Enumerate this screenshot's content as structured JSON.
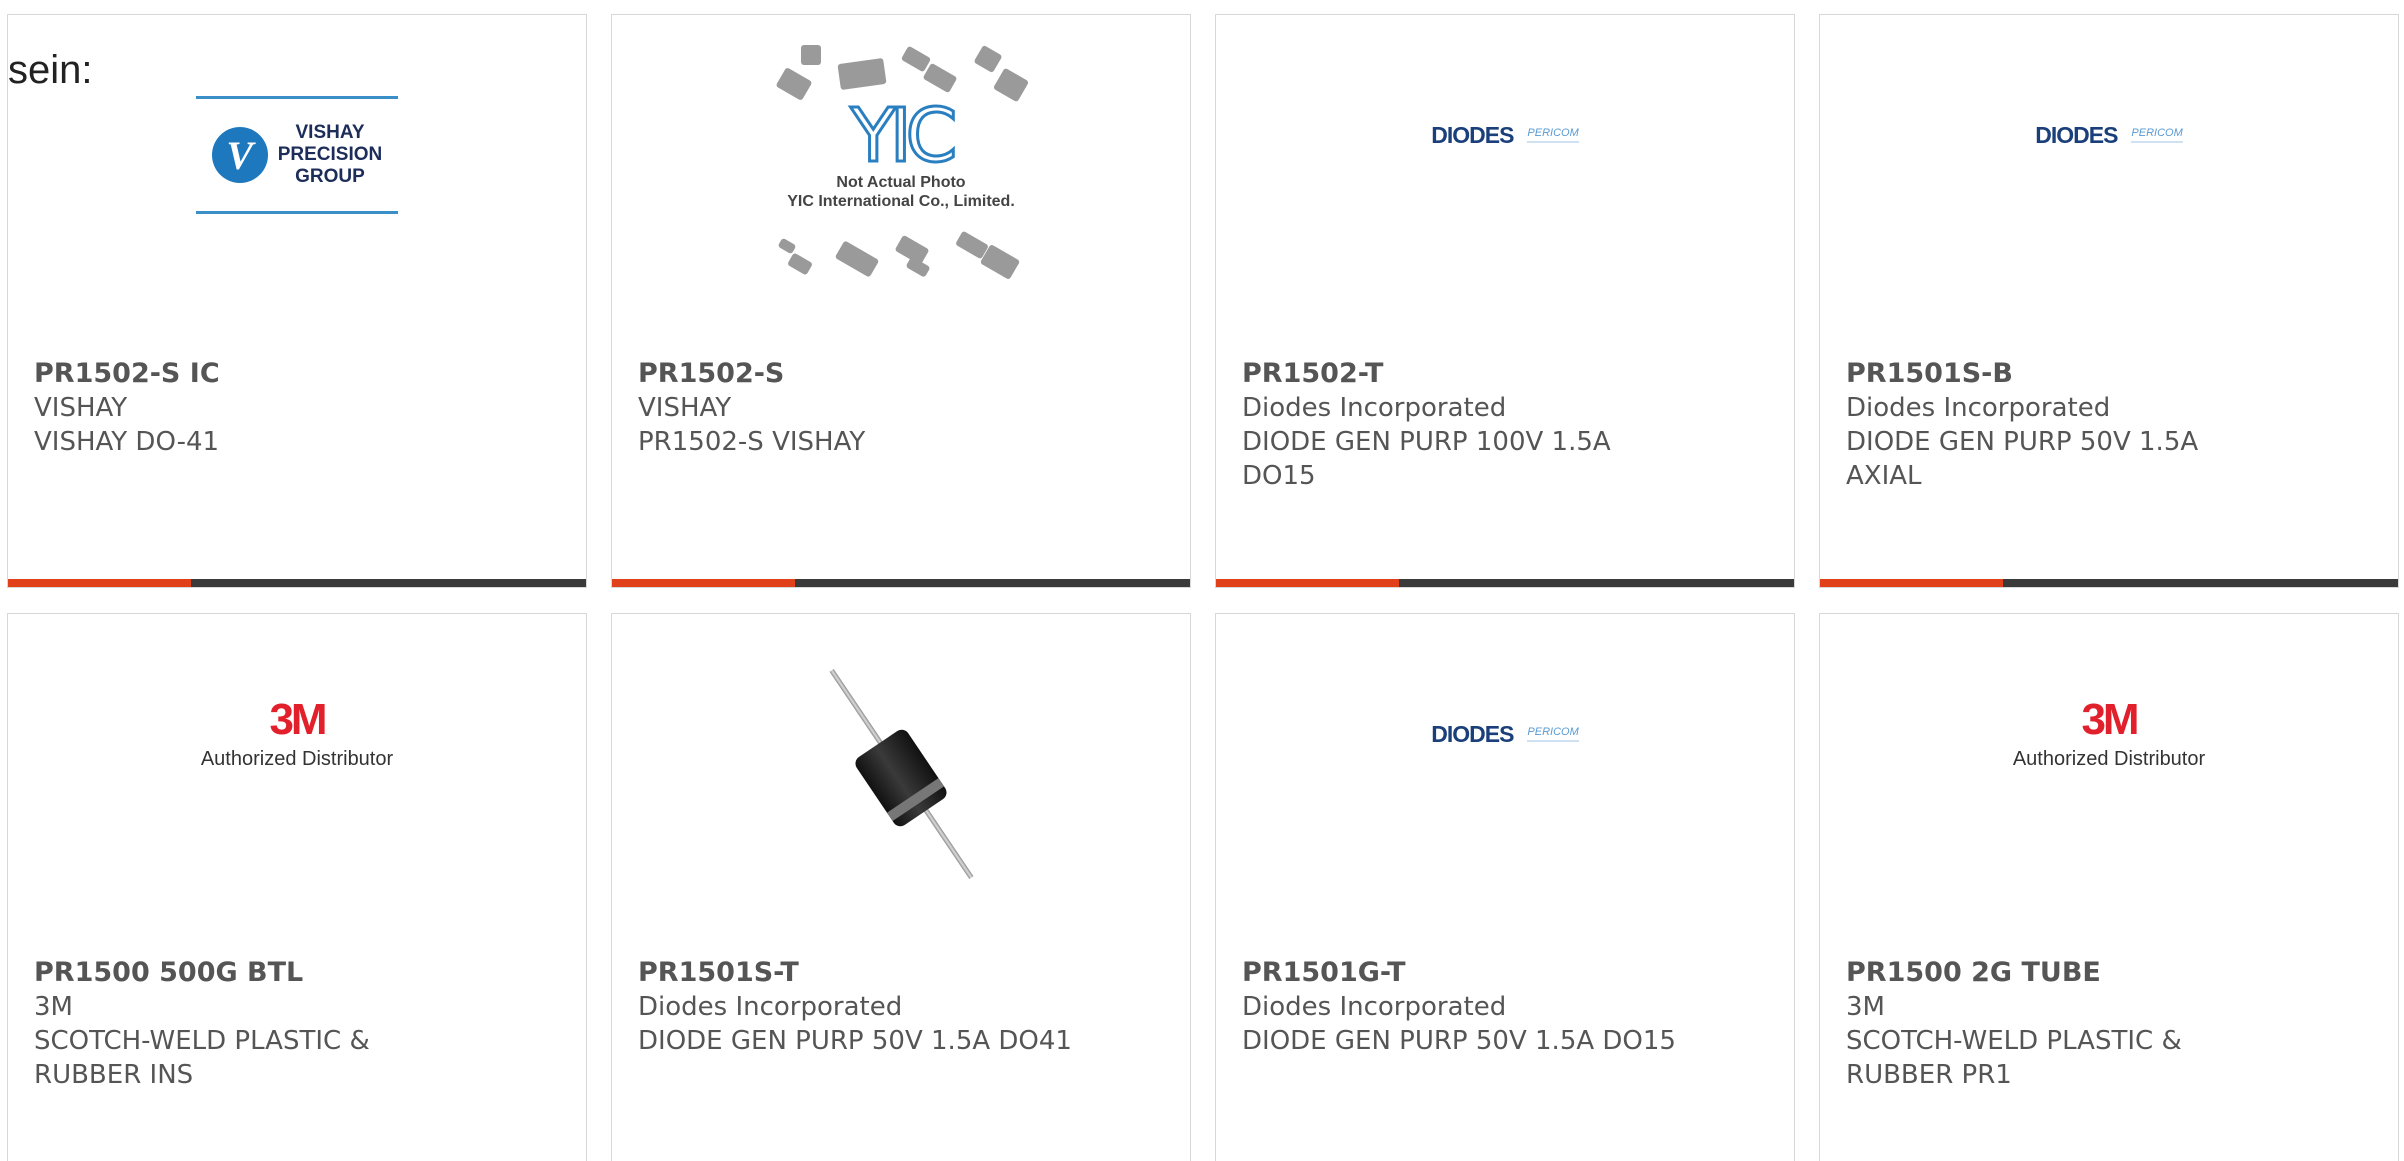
{
  "intro_text": "sein:",
  "colors": {
    "accent": "#e0401a",
    "bar": "#3a3a3a",
    "text": "#555555"
  },
  "products": [
    {
      "part_number": "PR1502-S IC",
      "manufacturer": "VISHAY",
      "description": "VISHAY DO-41",
      "image": "vishay-logo",
      "logo": {
        "lines": [
          "VISHAY",
          "PRECISION",
          "GROUP"
        ]
      }
    },
    {
      "part_number": "PR1502-S",
      "manufacturer": "VISHAY",
      "description": "PR1502-S VISHAY",
      "image": "yic-placeholder",
      "logo": {
        "letters": "YIC",
        "note_line1": "Not Actual Photo",
        "note_line2": "YIC International Co., Limited."
      }
    },
    {
      "part_number": "PR1502-T",
      "manufacturer": "Diodes Incorporated",
      "description": "DIODE GEN PURP 100V 1.5A DO15",
      "image": "diodes-logo",
      "logo": {
        "brand": "DIODES",
        "sub": "PERICOM"
      }
    },
    {
      "part_number": "PR1501S-B",
      "manufacturer": "Diodes Incorporated",
      "description": "DIODE GEN PURP 50V 1.5A AXIAL",
      "image": "diodes-logo",
      "logo": {
        "brand": "DIODES",
        "sub": "PERICOM"
      }
    },
    {
      "part_number": "PR1500 500G BTL",
      "manufacturer": "3M",
      "description": "SCOTCH-WELD PLASTIC & RUBBER INS",
      "image": "3m-logo",
      "logo": {
        "brand": "3M",
        "sub": "Authorized Distributor"
      }
    },
    {
      "part_number": "PR1501S-T",
      "manufacturer": "Diodes Incorporated",
      "description": "DIODE GEN PURP 50V 1.5A DO41",
      "image": "diode-photo"
    },
    {
      "part_number": "PR1501G-T",
      "manufacturer": "Diodes Incorporated",
      "description": "DIODE GEN PURP 50V 1.5A DO15",
      "image": "diodes-logo",
      "logo": {
        "brand": "DIODES",
        "sub": "PERICOM"
      }
    },
    {
      "part_number": "PR1500 2G TUBE",
      "manufacturer": "3M",
      "description": "SCOTCH-WELD PLASTIC & RUBBER PR1",
      "image": "3m-logo",
      "logo": {
        "brand": "3M",
        "sub": "Authorized Distributor"
      }
    }
  ]
}
